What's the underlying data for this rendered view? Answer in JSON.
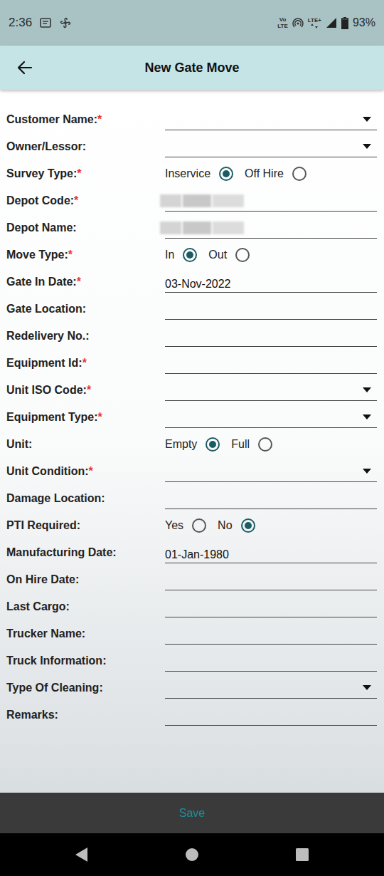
{
  "status_bar": {
    "time": "2:36",
    "volte_top": "Vo",
    "volte_bottom": "LTE",
    "network": "LTE+",
    "battery": "93%",
    "battery_level": 0.93
  },
  "header": {
    "title": "New Gate Move"
  },
  "fields": [
    {
      "label": "Customer Name:",
      "asterisk": "*",
      "kind": "dropdown"
    },
    {
      "label": "Owner/Lessor:",
      "kind": "dropdown"
    },
    {
      "label": "Survey Type:",
      "asterisk": "*",
      "kind": "radio",
      "options": [
        {
          "label": "Inservice",
          "selected": true
        },
        {
          "label": "Off Hire",
          "selected": false
        }
      ]
    },
    {
      "label": "Depot Code:",
      "asterisk": "*",
      "kind": "text",
      "redacted": true
    },
    {
      "label": "Depot Name:",
      "kind": "text",
      "redacted": true
    },
    {
      "label": "Move Type:",
      "asterisk": "*",
      "kind": "radio",
      "options": [
        {
          "label": "In",
          "selected": true
        },
        {
          "label": "Out",
          "selected": false
        }
      ]
    },
    {
      "label": "Gate In Date:",
      "asterisk": "*",
      "kind": "text",
      "value": "03-Nov-2022"
    },
    {
      "label": "Gate Location:",
      "kind": "text"
    },
    {
      "label": "Redelivery No.:",
      "kind": "text"
    },
    {
      "label": "Equipment Id:",
      "asterisk": "*",
      "kind": "text"
    },
    {
      "label": "Unit ISO Code:",
      "asterisk": "*",
      "kind": "dropdown"
    },
    {
      "label": "Equipment Type:",
      "asterisk": "*",
      "kind": "dropdown"
    },
    {
      "label": "Unit:",
      "kind": "radio",
      "options": [
        {
          "label": "Empty",
          "selected": true
        },
        {
          "label": "Full",
          "selected": false
        }
      ]
    },
    {
      "label": "Unit Condition:",
      "asterisk": "*",
      "kind": "dropdown"
    },
    {
      "label": "Damage Location:",
      "kind": "text"
    },
    {
      "label": "PTI Required:",
      "kind": "radio",
      "options": [
        {
          "label": "Yes",
          "selected": false
        },
        {
          "label": "No",
          "selected": true
        }
      ]
    },
    {
      "label": "Manufacturing Date:",
      "kind": "text",
      "value": "01-Jan-1980"
    },
    {
      "label": "On Hire Date:",
      "kind": "text"
    },
    {
      "label": "Last Cargo:",
      "kind": "text"
    },
    {
      "label": "Trucker Name:",
      "kind": "text"
    },
    {
      "label": "Truck Information:",
      "kind": "text"
    },
    {
      "label": "Type Of Cleaning:",
      "kind": "dropdown"
    },
    {
      "label": "Remarks:",
      "kind": "text"
    }
  ],
  "save_button": {
    "label": "Save"
  }
}
